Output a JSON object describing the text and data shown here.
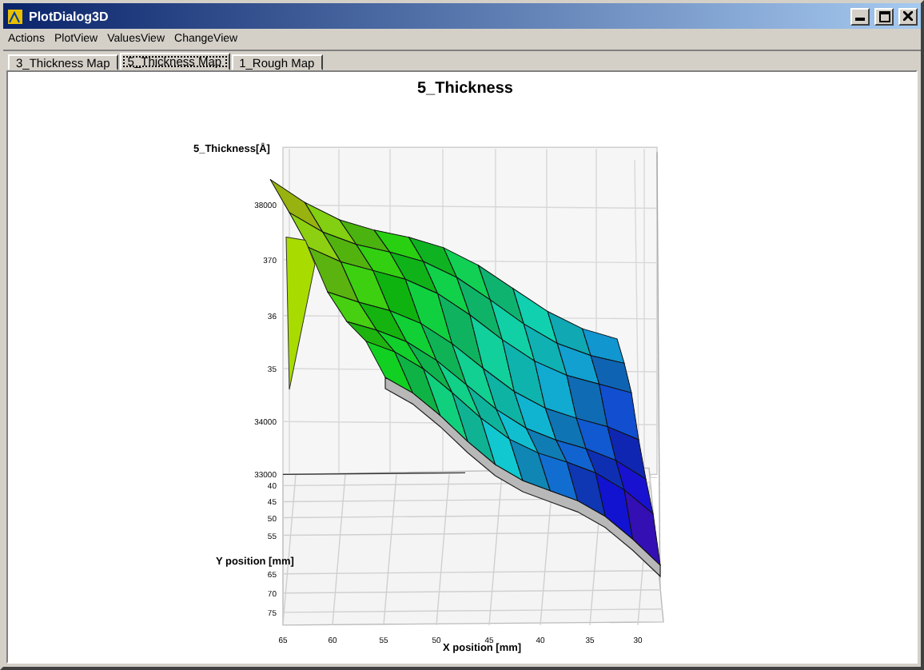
{
  "window": {
    "title": "PlotDialog3D"
  },
  "menu": [
    "Actions",
    "PlotView",
    "ValuesView",
    "ChangeView"
  ],
  "tabs": [
    {
      "label": "3_Thickness Map",
      "selected": false
    },
    {
      "label": "5_Thickness Map",
      "selected": true
    },
    {
      "label": "1_Rough Map",
      "selected": false
    }
  ],
  "plot": {
    "title": "5_Thickness",
    "z_axis_label": "5_Thickness[Å]",
    "z_ticks": [
      "38000",
      "370",
      "36",
      "35",
      "34000",
      "33000"
    ],
    "y_axis_label": "Y position [mm]",
    "y_ticks": [
      "40",
      "45",
      "50",
      "55",
      "65",
      "70",
      "75"
    ],
    "x_axis_label": "X position [mm]",
    "x_ticks": [
      "65",
      "60",
      "55",
      "50",
      "45",
      "40",
      "35",
      "30"
    ]
  }
}
